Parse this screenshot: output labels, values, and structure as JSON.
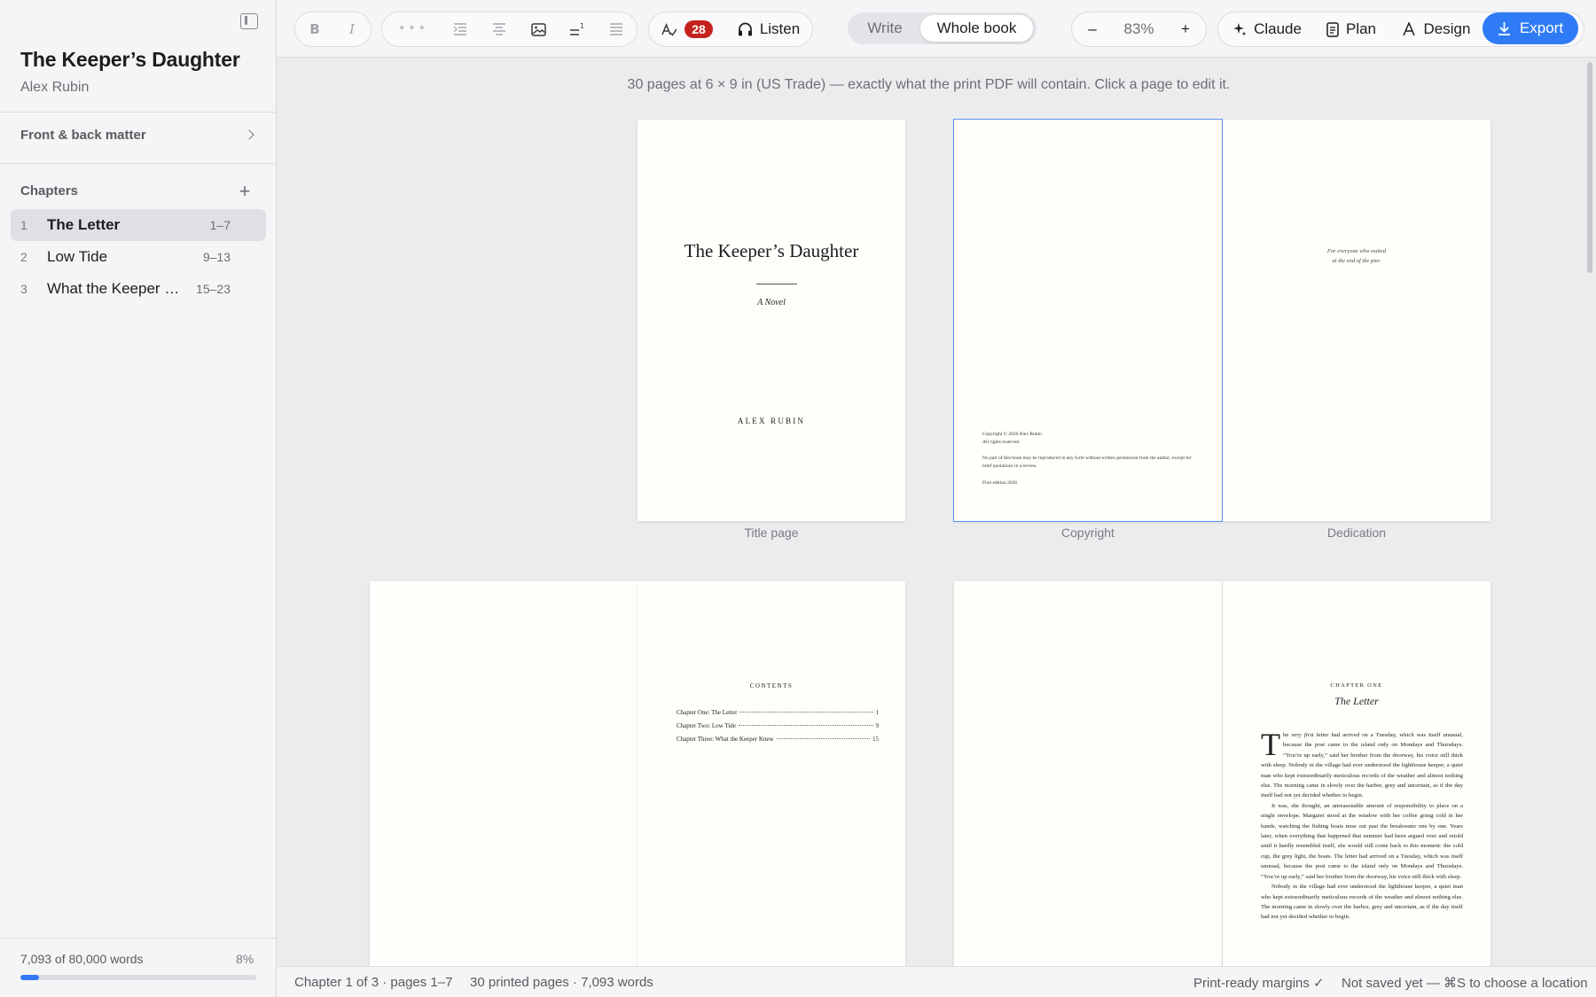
{
  "sidebar": {
    "book_title": "The Keeper’s Daughter",
    "author": "Alex Rubin",
    "front_back_matter": "Front & back matter",
    "chapters_header": "Chapters",
    "add_symbol": "+",
    "chapters": [
      {
        "num": "1",
        "name": "The Letter",
        "pages": "1–7",
        "active": true
      },
      {
        "num": "2",
        "name": "Low Tide",
        "pages": "9–13",
        "active": false
      },
      {
        "num": "3",
        "name": "What the Keeper Knew",
        "pages": "15–23",
        "active": false
      }
    ],
    "word_count": "7,093 of 80,000 words",
    "progress_label": "8%",
    "progress": 0.08
  },
  "toolbar": {
    "bold": "B",
    "italic": "I",
    "scene_break": "* * *",
    "issues_count": "28",
    "listen": "Listen",
    "mode_write": "Write",
    "mode_whole_book": "Whole book",
    "zoom_out": "–",
    "zoom": "83%",
    "zoom_in": "+",
    "claude": "Claude",
    "plan": "Plan",
    "design": "Design",
    "export": "Export"
  },
  "main": {
    "info": "30 pages at 6 × 9 in (US Trade) — exactly what the print PDF will contain. Click a page to edit it.",
    "captions": {
      "title_page": "Title page",
      "copyright": "Copyright",
      "dedication": "Dedication"
    },
    "title_page": {
      "title": "The Keeper’s Daughter",
      "subtitle": "A Novel",
      "author": "ALEX RUBIN"
    },
    "copyright": {
      "line1": "Copyright © 2026 Alex Rubin",
      "line2": "All rights reserved.",
      "line3": "No part of this book may be reproduced in any form without written permission from the author, except for brief quotations in a review.",
      "line4": "First edition 2026"
    },
    "dedication": {
      "line1": "For everyone who waited",
      "line2": "at the end of the pier."
    },
    "contents": {
      "heading": "CONTENTS",
      "entries": [
        {
          "name": "Chapter One: The Letter",
          "page": "1"
        },
        {
          "name": "Chapter Two: Low Tide",
          "page": "9"
        },
        {
          "name": "Chapter Three: What the Keeper Knew",
          "page": "15"
        }
      ]
    },
    "chapter_page": {
      "label": "CHAPTER ONE",
      "title": "The Letter",
      "dropcap": "T",
      "first_word_rest": "he ",
      "first_emph": "very first",
      "p1": " letter had arrived on a Tuesday, which was itself unusual, because the post came to the island only on Mondays and Thursdays. “You’re up early,” said her brother from the doorway, his voice still thick with sleep. Nobody in the village had ever understood the lighthouse keeper, a quiet man who kept extraordinarily meticulous records of the weather and almost nothing else. The morning came in slowly over the harbor, grey and uncertain, as if the day itself had not yet decided whether to begin.",
      "p2": "It was, she thought, an unreasonable amount of responsibility to place on a single envelope. Margaret stood at the window with her coffee going cold in her hands, watching the fishing boats nose out past the breakwater one by one. Years later, when everything that happened that summer had been argued over and retold until it hardly resembled itself, she would still come back to this moment: the cold cup, the grey light, the boats. The letter had arrived on a Tuesday, which was itself unusual, because the post came to the island only on Mondays and Thursdays. “You’re up early,” said her brother from the doorway, his voice still thick with sleep.",
      "p3": "Nobody in the village had ever understood the lighthouse keeper, a quiet man who kept extraordinarily meticulous records of the weather and almost nothing else. The morning came in slowly over the harbor, grey and uncertain, as if the day itself had not yet decided whether to begin."
    }
  },
  "status": {
    "location": "Chapter 1 of 3 · pages 1–7",
    "totals": "30 printed pages · 7,093 words",
    "margins": "Print-ready margins ✓",
    "save": "Not saved yet — ⌘S to choose a location"
  }
}
